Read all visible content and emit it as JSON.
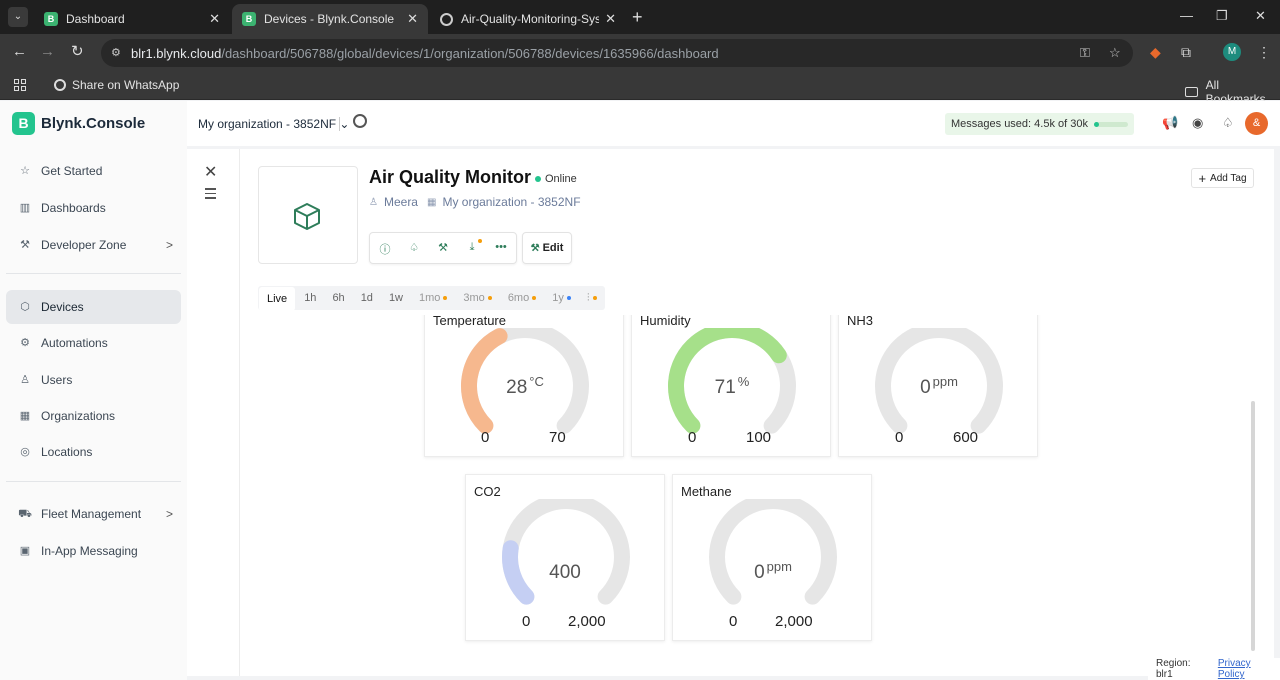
{
  "browser": {
    "tabs": [
      {
        "title": "Dashboard",
        "favicon": "B"
      },
      {
        "title": "Devices - Blynk.Console",
        "favicon": "B"
      },
      {
        "title": "Air-Quality-Monitoring-System",
        "favicon": ""
      }
    ],
    "url_host": "blr1.blynk.cloud",
    "url_path": "/dashboard/506788/global/devices/1/organization/506788/devices/1635966/dashboard",
    "bookmarks": {
      "share": "Share on WhatsApp",
      "all": "All Bookmarks"
    },
    "profile_initial": "M"
  },
  "app": {
    "logo_letter": "B",
    "logo_text": "Blynk.Console",
    "nav": [
      {
        "label": "Get Started",
        "icon": "star-icon"
      },
      {
        "label": "Dashboards",
        "icon": "chart-icon"
      },
      {
        "label": "Developer Zone",
        "icon": "wrench-icon"
      },
      {
        "label": "Devices",
        "icon": "cube-icon"
      },
      {
        "label": "Automations",
        "icon": "automation-icon"
      },
      {
        "label": "Users",
        "icon": "user-icon"
      },
      {
        "label": "Organizations",
        "icon": "building-icon"
      },
      {
        "label": "Locations",
        "icon": "pin-icon"
      },
      {
        "label": "Fleet Management",
        "icon": "truck-icon"
      },
      {
        "label": "In-App Messaging",
        "icon": "message-icon"
      }
    ],
    "org": "My organization - 3852NF",
    "messages_label": "Messages used:",
    "messages_value": "4.5k of 30k",
    "messages_fraction": 0.15,
    "avatar_initial": "&"
  },
  "device": {
    "name": "Air Quality Monitor",
    "status": "Online",
    "owner": "Meera",
    "organization": "My organization - 3852NF",
    "edit_label": "Edit",
    "add_tag_label": "Add Tag"
  },
  "time_ranges": [
    "Live",
    "1h",
    "6h",
    "1d",
    "1w",
    "1mo",
    "3mo",
    "6mo",
    "1y"
  ],
  "gauges": [
    {
      "title": "Temperature",
      "value": "28",
      "unit": "°C",
      "min": "0",
      "max": "70",
      "fraction": 0.4,
      "color": "#f6b88e"
    },
    {
      "title": "Humidity",
      "value": "71",
      "unit": "%",
      "min": "0",
      "max": "100",
      "fraction": 0.71,
      "color": "#a6e08a"
    },
    {
      "title": "NH3",
      "value": "0",
      "unit": "ppm",
      "min": "0",
      "max": "600",
      "fraction": 0,
      "color": "#cccccc"
    },
    {
      "title": "CO2",
      "value": "400",
      "unit": "",
      "min": "0",
      "max": "2,000",
      "fraction": 0.2,
      "color": "#c5cff3"
    },
    {
      "title": "Methane",
      "value": "0",
      "unit": "ppm",
      "min": "0",
      "max": "2,000",
      "fraction": 0,
      "color": "#cccccc"
    }
  ],
  "footer": {
    "region": "Region: blr1",
    "privacy": "Privacy Policy"
  }
}
